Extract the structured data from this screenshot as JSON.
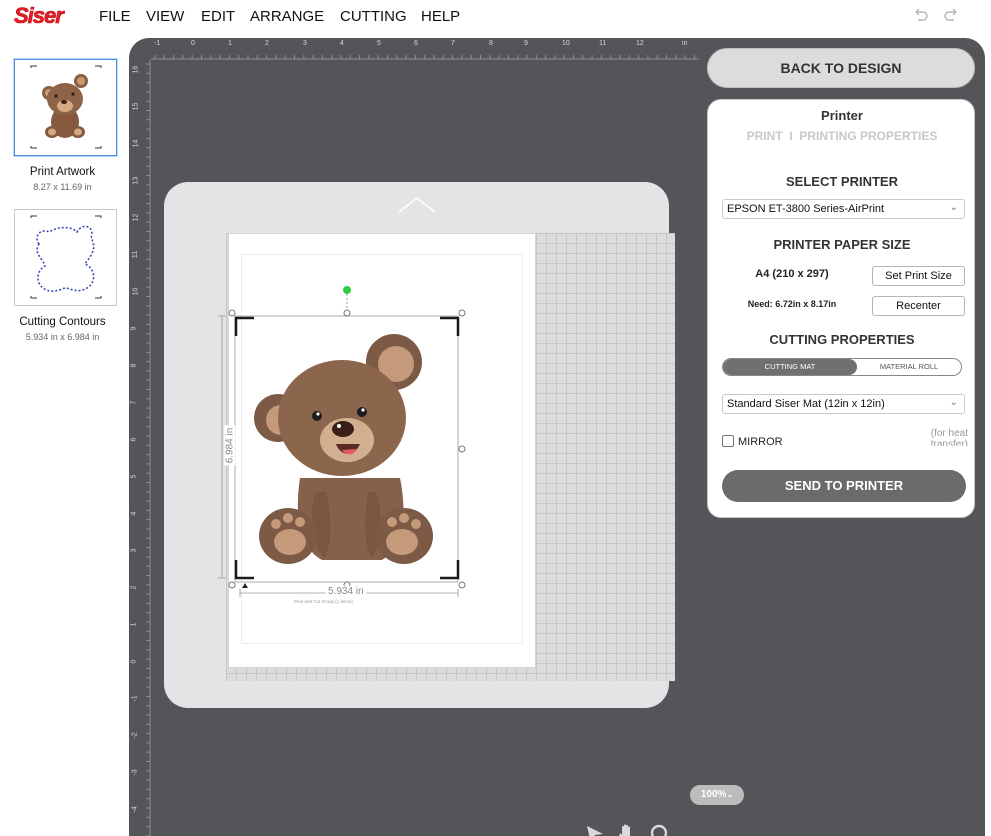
{
  "app": {
    "logo": "Siser"
  },
  "menu": [
    "FILE",
    "VIEW",
    "EDIT",
    "ARRANGE",
    "CUTTING",
    "HELP"
  ],
  "layers": [
    {
      "label": "Print Artwork",
      "size": "8.27 x 11.69 in"
    },
    {
      "label": "Cutting Contours",
      "size": "5.934 in x 6.984 in"
    }
  ],
  "ruler": {
    "top": [
      "-1",
      "0",
      "1",
      "2",
      "3",
      "4",
      "5",
      "6",
      "7",
      "8",
      "9",
      "10",
      "11",
      "12",
      "in"
    ],
    "left": [
      "16",
      "15",
      "14",
      "13",
      "12",
      "11",
      "10",
      "9",
      "8",
      "7",
      "6",
      "5",
      "4",
      "3",
      "2",
      "1",
      "0",
      "-1",
      "-2",
      "-3",
      "-4"
    ]
  },
  "canvas": {
    "height_label": "6.984 in",
    "width_label": "5.934 in",
    "group_label": "Print and Cut Group (1 items)"
  },
  "panel": {
    "back_button": "BACK TO DESIGN",
    "title": "Printer",
    "subtabs": "PRINT  I  PRINTING PROPERTIES",
    "select_printer_heading": "SELECT PRINTER",
    "printer_value": "EPSON ET-3800 Series-AirPrint",
    "paper_size_heading": "PRINTER PAPER SIZE",
    "paper_value": "A4 (210 x 297)",
    "set_print_size": "Set Print Size",
    "need_text": "Need: 6.72in x 8.17in",
    "recenter": "Recenter",
    "cutting_heading": "CUTTING PROPERTIES",
    "seg_on": "CUTTING MAT",
    "seg_off": "MATERIAL ROLL",
    "mat_value": "Standard Siser Mat (12in x 12in)",
    "mirror_label": "MIRROR",
    "mirror_note": "(for heat transfer)",
    "send_button": "SEND TO PRINTER"
  },
  "zoom": "100%",
  "colors": {
    "brand": "#e0202e",
    "workspace": "#545559",
    "accent_green": "#2ecc40"
  }
}
